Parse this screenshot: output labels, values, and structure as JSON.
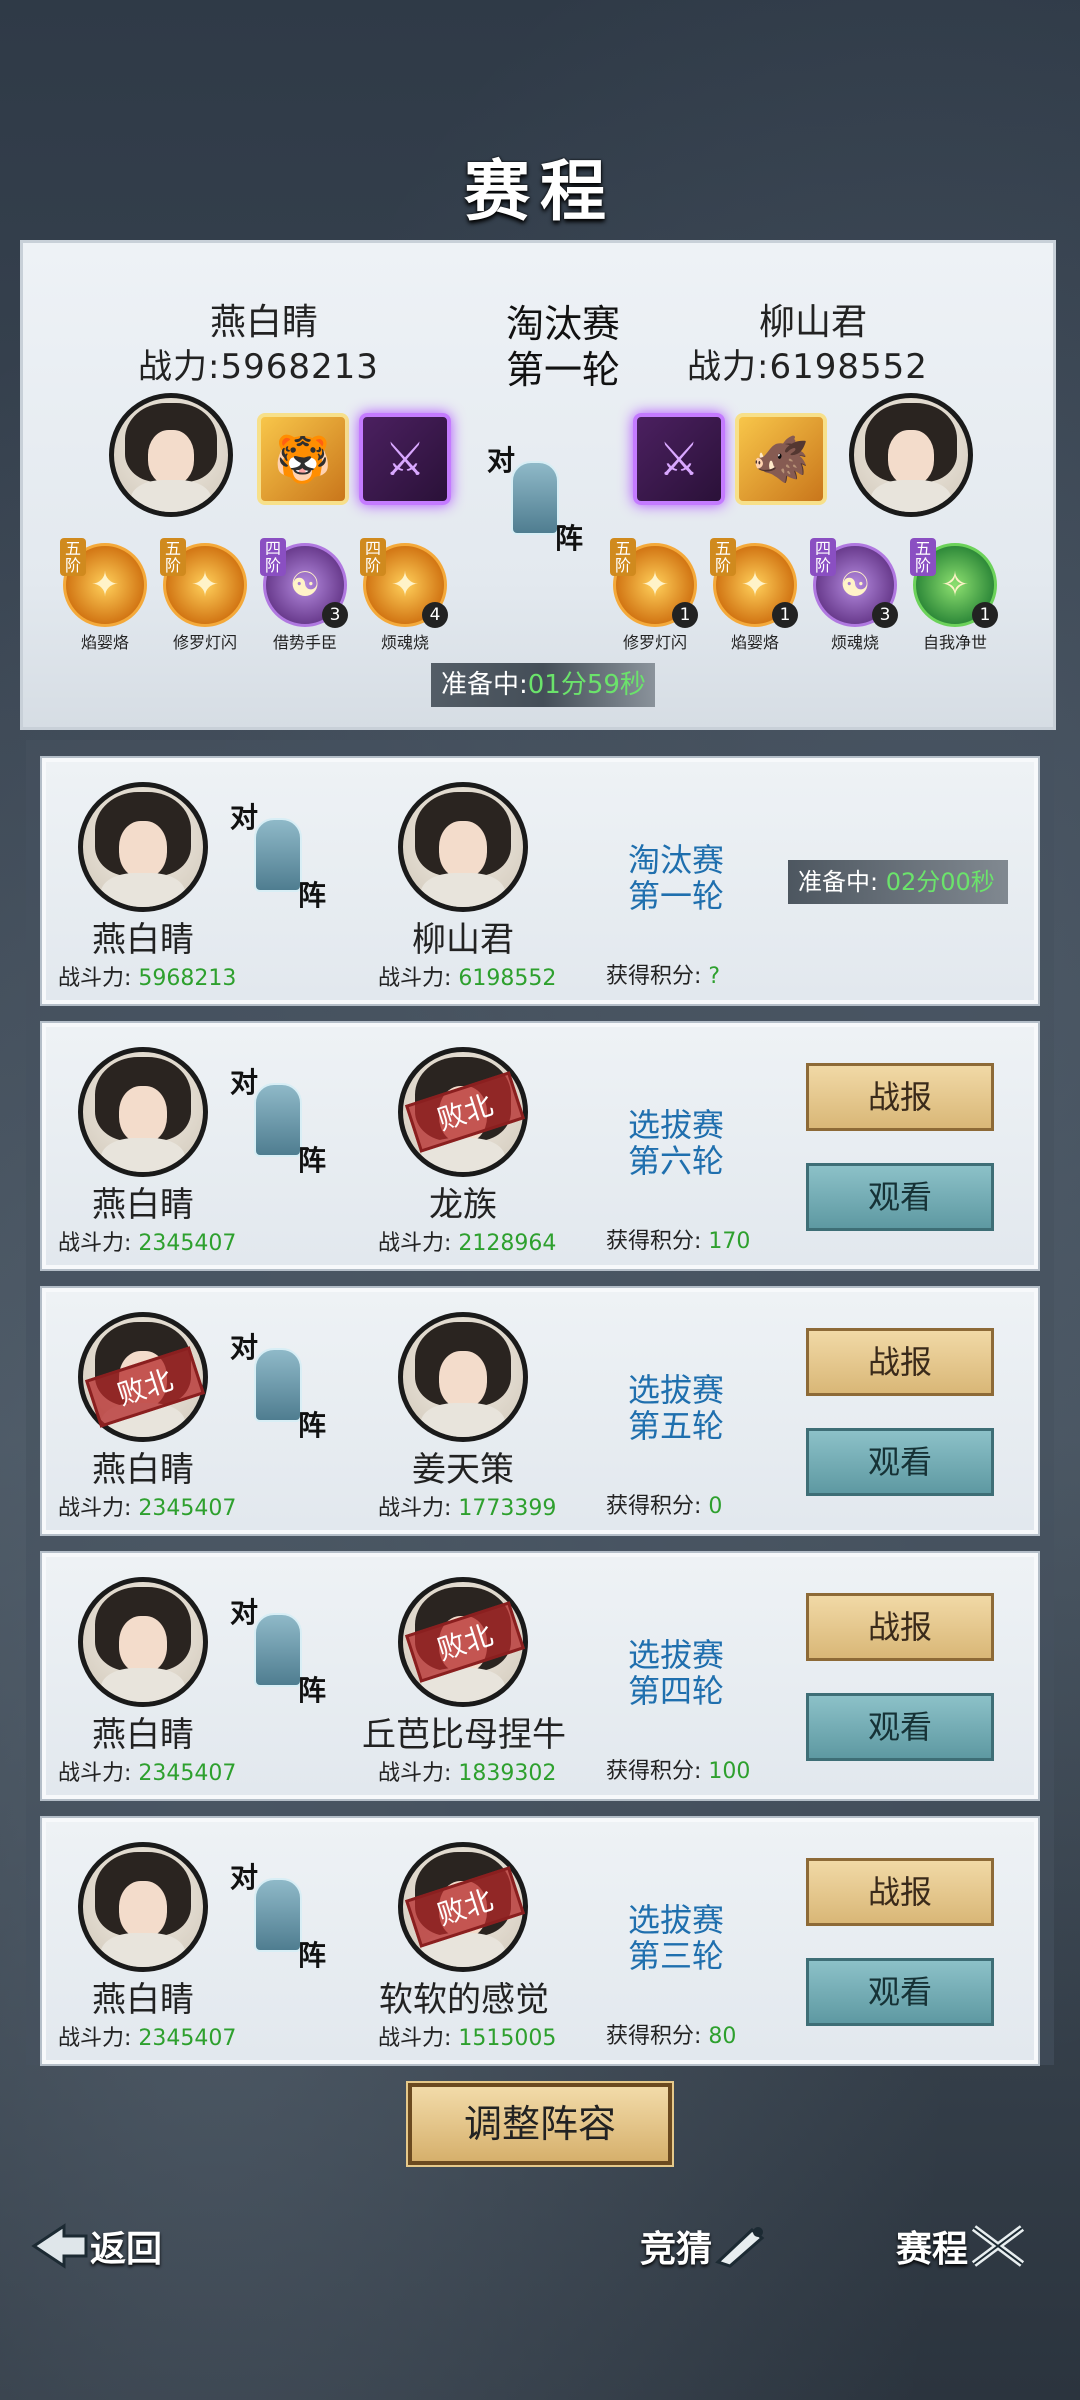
{
  "title": "赛程",
  "current_match": {
    "left": {
      "name": "燕白睛",
      "power_label": "战力:",
      "power": "5968213"
    },
    "right": {
      "name": "柳山君",
      "power_label": "战力:",
      "power": "6198552"
    },
    "stage": "淘汰赛",
    "round": "第一轮",
    "vs_top": "对",
    "vs_bottom": "阵",
    "left_skills": [
      {
        "tier": "五阶",
        "name": "焰婴烙",
        "level": ""
      },
      {
        "tier": "五阶",
        "name": "修罗灯闪",
        "level": ""
      },
      {
        "tier": "四阶",
        "name": "借势手臣",
        "level": "3"
      },
      {
        "tier": "四阶",
        "name": "烦魂烧",
        "level": "4"
      }
    ],
    "right_skills": [
      {
        "tier": "五阶",
        "name": "修罗灯闪",
        "level": "1"
      },
      {
        "tier": "五阶",
        "name": "焰婴烙",
        "level": "1"
      },
      {
        "tier": "四阶",
        "name": "烦魂烧",
        "level": "3"
      },
      {
        "tier": "五阶",
        "name": "自我净世",
        "level": "1"
      }
    ],
    "prep_label": "准备中:",
    "prep_time": "01分59秒"
  },
  "matches": [
    {
      "left_name": "燕白睛",
      "left_power": "5968213",
      "right_name": "柳山君",
      "right_power": "6198552",
      "stage": "淘汰赛",
      "round": "第一轮",
      "score": "?",
      "prep_label": "准备中:",
      "prep_time": "02分00秒"
    },
    {
      "left_name": "燕白睛",
      "left_power": "2345407",
      "right_name": "龙族",
      "right_power": "2128964",
      "stage": "选拔赛",
      "round": "第六轮",
      "score": "170",
      "defeat": "败北"
    },
    {
      "left_name": "燕白睛",
      "left_power": "2345407",
      "right_name": "姜天策",
      "right_power": "1773399",
      "stage": "选拔赛",
      "round": "第五轮",
      "score": "0",
      "defeat": "败北"
    },
    {
      "left_name": "燕白睛",
      "left_power": "2345407",
      "right_name": "丘芭比母捏牛",
      "right_power": "1839302",
      "stage": "选拔赛",
      "round": "第四轮",
      "score": "100",
      "defeat": "败北"
    },
    {
      "left_name": "燕白睛",
      "left_power": "2345407",
      "right_name": "软软的感觉",
      "right_power": "1515005",
      "stage": "选拔赛",
      "round": "第三轮",
      "score": "80",
      "defeat": "败北"
    }
  ],
  "labels": {
    "power": "战斗力:",
    "score": "获得积分:",
    "report": "战报",
    "watch": "观看"
  },
  "adjust_button": "调整阵容",
  "nav": {
    "back": "返回",
    "guess": "竞猜",
    "schedule": "赛程"
  },
  "colors": {
    "power_value": "#2ea02e",
    "round_text": "#1f6fae",
    "prep_time": "#6be36b"
  }
}
